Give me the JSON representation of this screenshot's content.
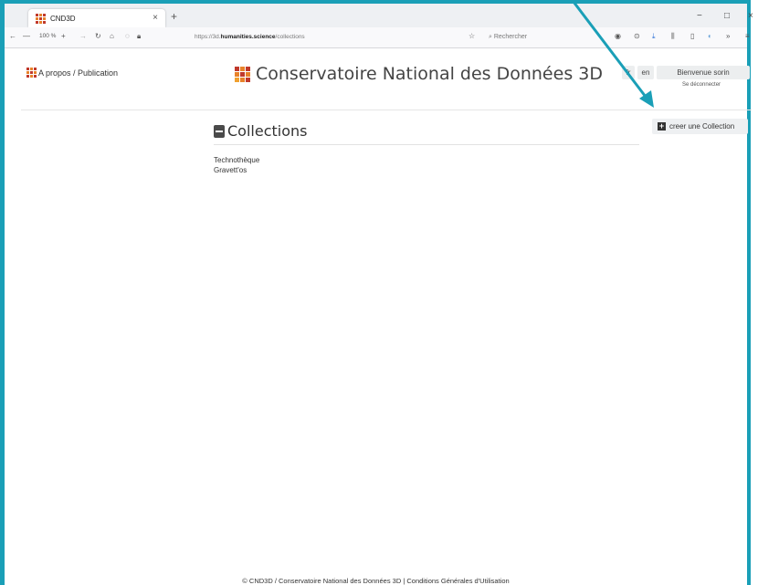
{
  "browser": {
    "tab_title": "CND3D",
    "tab_close": "×",
    "new_tab": "+",
    "zoom_minus": "—",
    "zoom_level": "100 %",
    "zoom_plus": "+",
    "url_prefix": "https://3d.",
    "url_domain": "humanities.science",
    "url_path": "/collections",
    "search_placeholder": "Rechercher",
    "window_min": "−",
    "window_max": "□",
    "window_close": "×"
  },
  "header": {
    "about_link": "A propos / Publication",
    "site_title": "Conservatoire National des Données 3D",
    "lang_fr": "fr",
    "lang_en": "en",
    "welcome": "Bienvenue sorin",
    "logout": "Se déconnecter"
  },
  "main": {
    "heading": "Collections",
    "create_button": "creer une Collection",
    "collections": [
      "Technothèque",
      "Gravett'os"
    ]
  },
  "footer": {
    "text": "© CND3D / Conservatoire National des Données 3D | Conditions Générales d'Utilisation"
  },
  "colors": {
    "accent_border": "#1a9fb7",
    "logo_orange": "#e8822a",
    "logo_red": "#c0392b"
  }
}
